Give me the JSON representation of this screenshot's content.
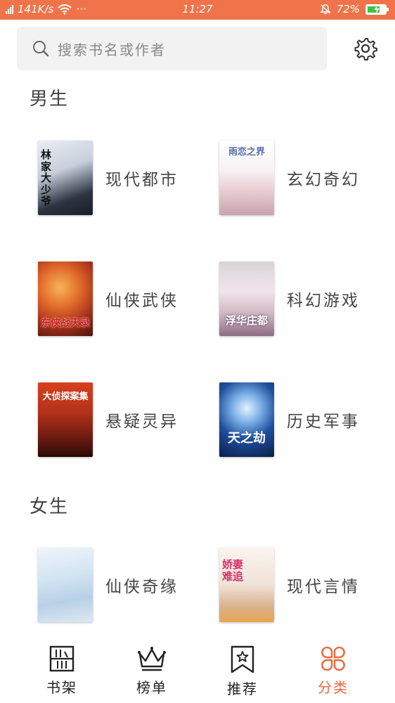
{
  "status_bar": {
    "network_speed": "141K/s",
    "more": "···",
    "time": "11:27",
    "battery": "72%",
    "battery_level": 0.72,
    "accent": "#f0734a"
  },
  "search": {
    "placeholder": "搜索书名或作者",
    "icon": "search-icon"
  },
  "settings": {
    "icon": "gear-icon"
  },
  "sections": [
    {
      "title": "男生",
      "categories": [
        {
          "label": "现代都市",
          "cover_text": "林家大少爷"
        },
        {
          "label": "玄幻奇幻",
          "cover_text": "雨恋之界"
        },
        {
          "label": "仙侠武侠",
          "cover_text": "东侠战天录"
        },
        {
          "label": "科幻游戏",
          "cover_text": "浮华庄都"
        },
        {
          "label": "悬疑灵异",
          "cover_text": "大侦探案集"
        },
        {
          "label": "历史军事",
          "cover_text": "天之劫"
        }
      ]
    },
    {
      "title": "女生",
      "categories": [
        {
          "label": "仙侠奇缘",
          "cover_text": ""
        },
        {
          "label": "现代言情",
          "cover_text": "娇妻难追"
        }
      ]
    }
  ],
  "tab_bar": [
    {
      "label": "书架",
      "icon": "bookshelf-icon",
      "active": false
    },
    {
      "label": "榜单",
      "icon": "crown-icon",
      "active": false
    },
    {
      "label": "推荐",
      "icon": "bookmark-star-icon",
      "active": false
    },
    {
      "label": "分类",
      "icon": "category-grid-icon",
      "active": true
    }
  ],
  "colors": {
    "active_tab": "#ea6a3b",
    "search_bg": "#f2f2f2"
  }
}
